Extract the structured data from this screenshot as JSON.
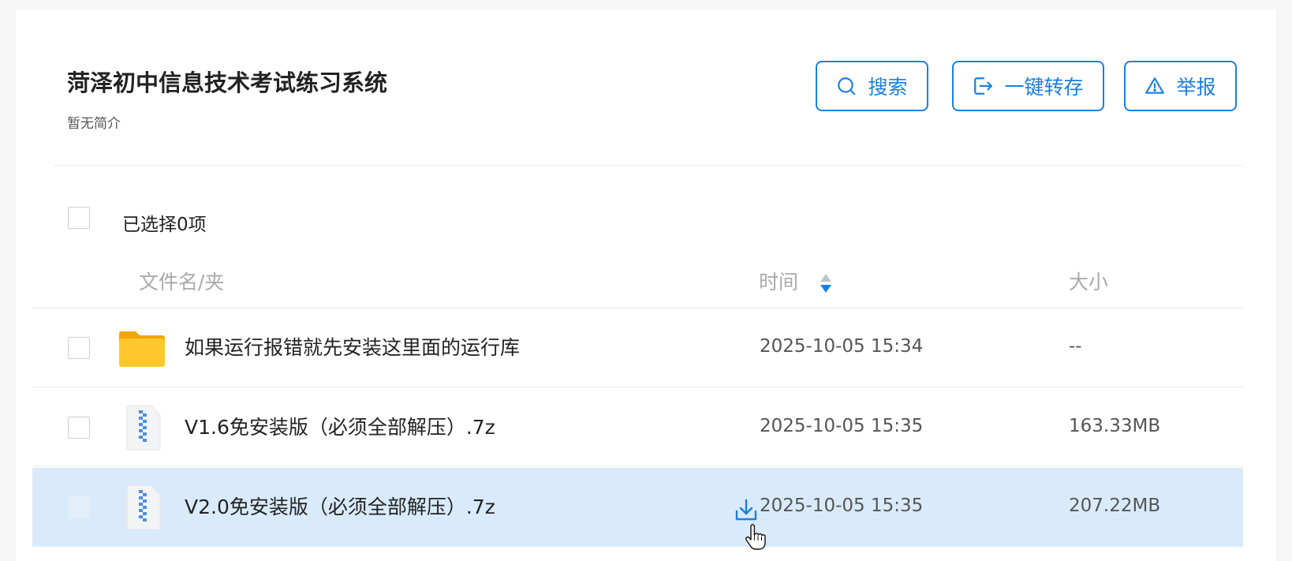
{
  "page": {
    "title": "菏泽初中信息技术考试练习系统",
    "description": "暂无简介"
  },
  "actions": {
    "search_label": "搜索",
    "save_label": "一键转存",
    "report_label": "举报"
  },
  "selection": {
    "count_text": "已选择0项"
  },
  "columns": {
    "name": "文件名/夹",
    "time": "时间",
    "size": "大小"
  },
  "files": [
    {
      "name": "如果运行报错就先安装这里面的运行库",
      "time": "2025-10-05 15:34",
      "size": "--",
      "icon": "folder-icon"
    },
    {
      "name": "V1.6免安装版（必须全部解压）.7z",
      "time": "2025-10-05 15:35",
      "size": "163.33MB",
      "icon": "zip-file-icon"
    },
    {
      "name": "V2.0免安装版（必须全部解压）.7z",
      "time": "2025-10-05 15:35",
      "size": "207.22MB",
      "icon": "zip-file-icon",
      "hovered": true
    }
  ],
  "colors": {
    "accent": "#1a7fe0",
    "hover_row": "#d9ebfb",
    "folder": "#ffc72c"
  }
}
